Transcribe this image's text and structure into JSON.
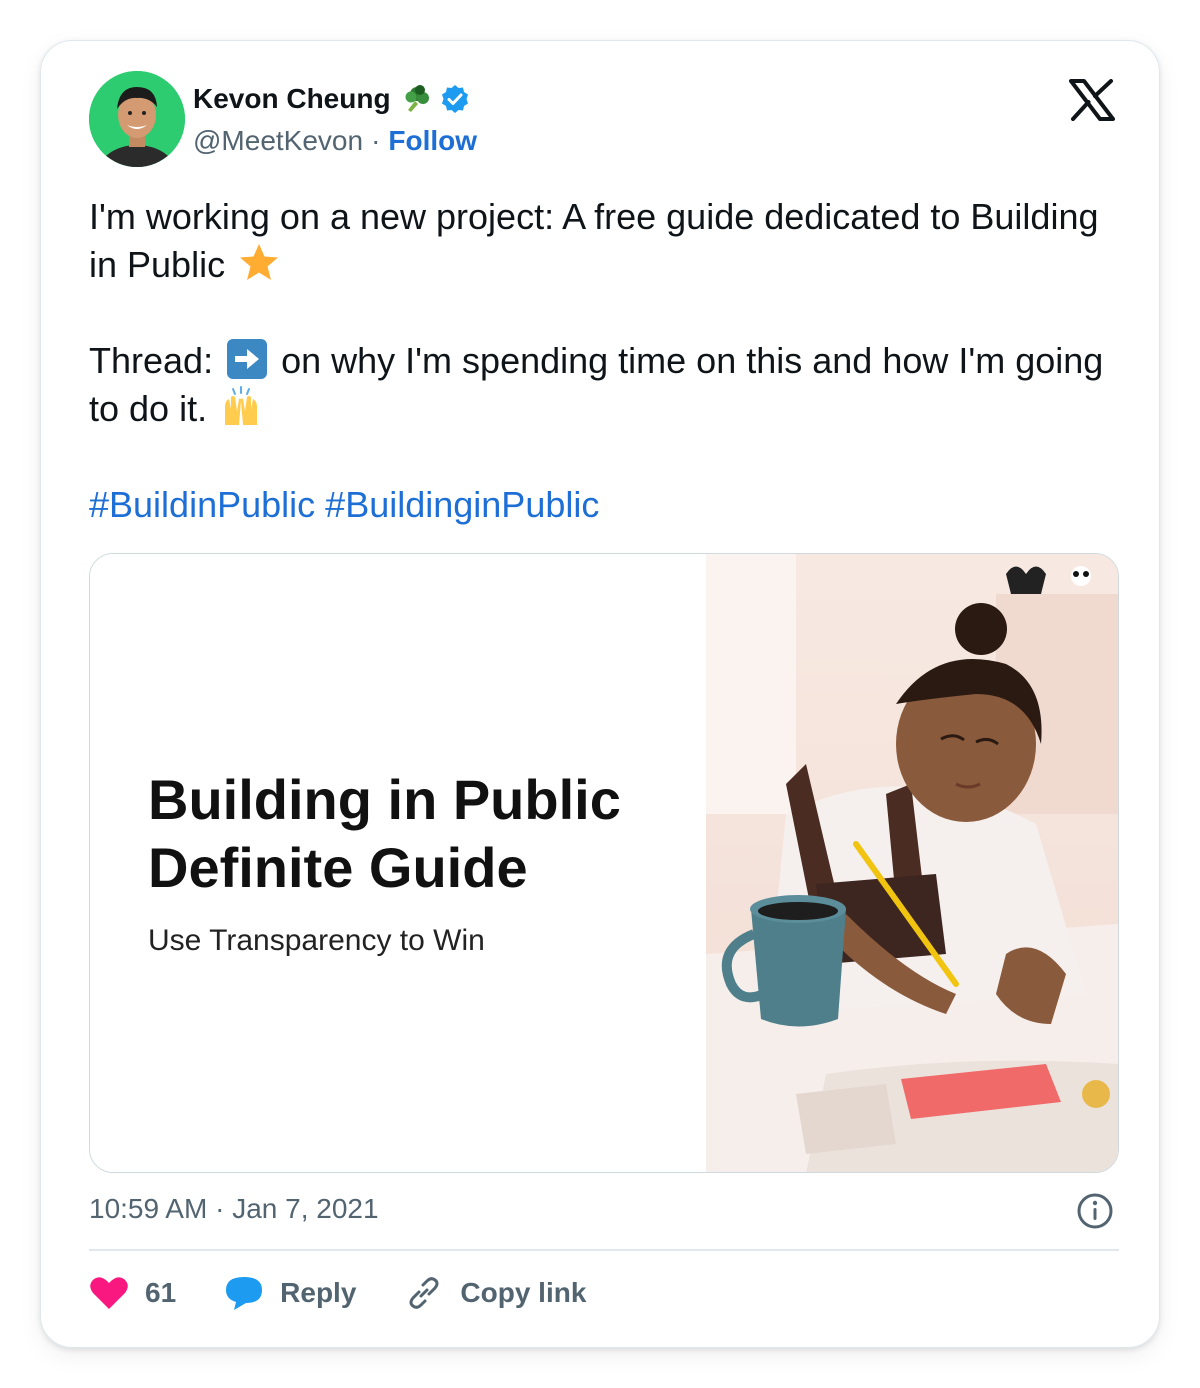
{
  "author": {
    "name": "Kevon Cheung",
    "handle": "@MeetKevon",
    "separator": "·",
    "follow_label": "Follow",
    "avatar_bg": "#2ecc71",
    "badges": [
      "broccoli-emoji",
      "verified-badge-icon"
    ]
  },
  "tweet": {
    "line1": "I'm working on a new project: A free guide dedicated to Building in Public",
    "line2_a": "Thread:",
    "line2_b": "on why I'm spending time on this and how I'm going to do it.",
    "hashtags": [
      "#BuildinPublic",
      "#BuildinginPublic"
    ],
    "emojis": [
      "star-emoji",
      "right-arrow-emoji",
      "raising-hands-emoji"
    ]
  },
  "media": {
    "title_line1": "Building in Public",
    "title_line2": "Definite Guide",
    "subtitle": "Use Transparency to Win",
    "image": "child-drawing-photo"
  },
  "meta": {
    "time": "10:59 AM",
    "separator": "·",
    "date": "Jan 7, 2021"
  },
  "actions": {
    "likes_count": "61",
    "reply_label": "Reply",
    "copy_link_label": "Copy link"
  },
  "colors": {
    "link": "#1d6fd6",
    "like": "#f91880",
    "reply": "#1d9bf0",
    "muted": "#536471",
    "verified": "#1d9bf0"
  }
}
